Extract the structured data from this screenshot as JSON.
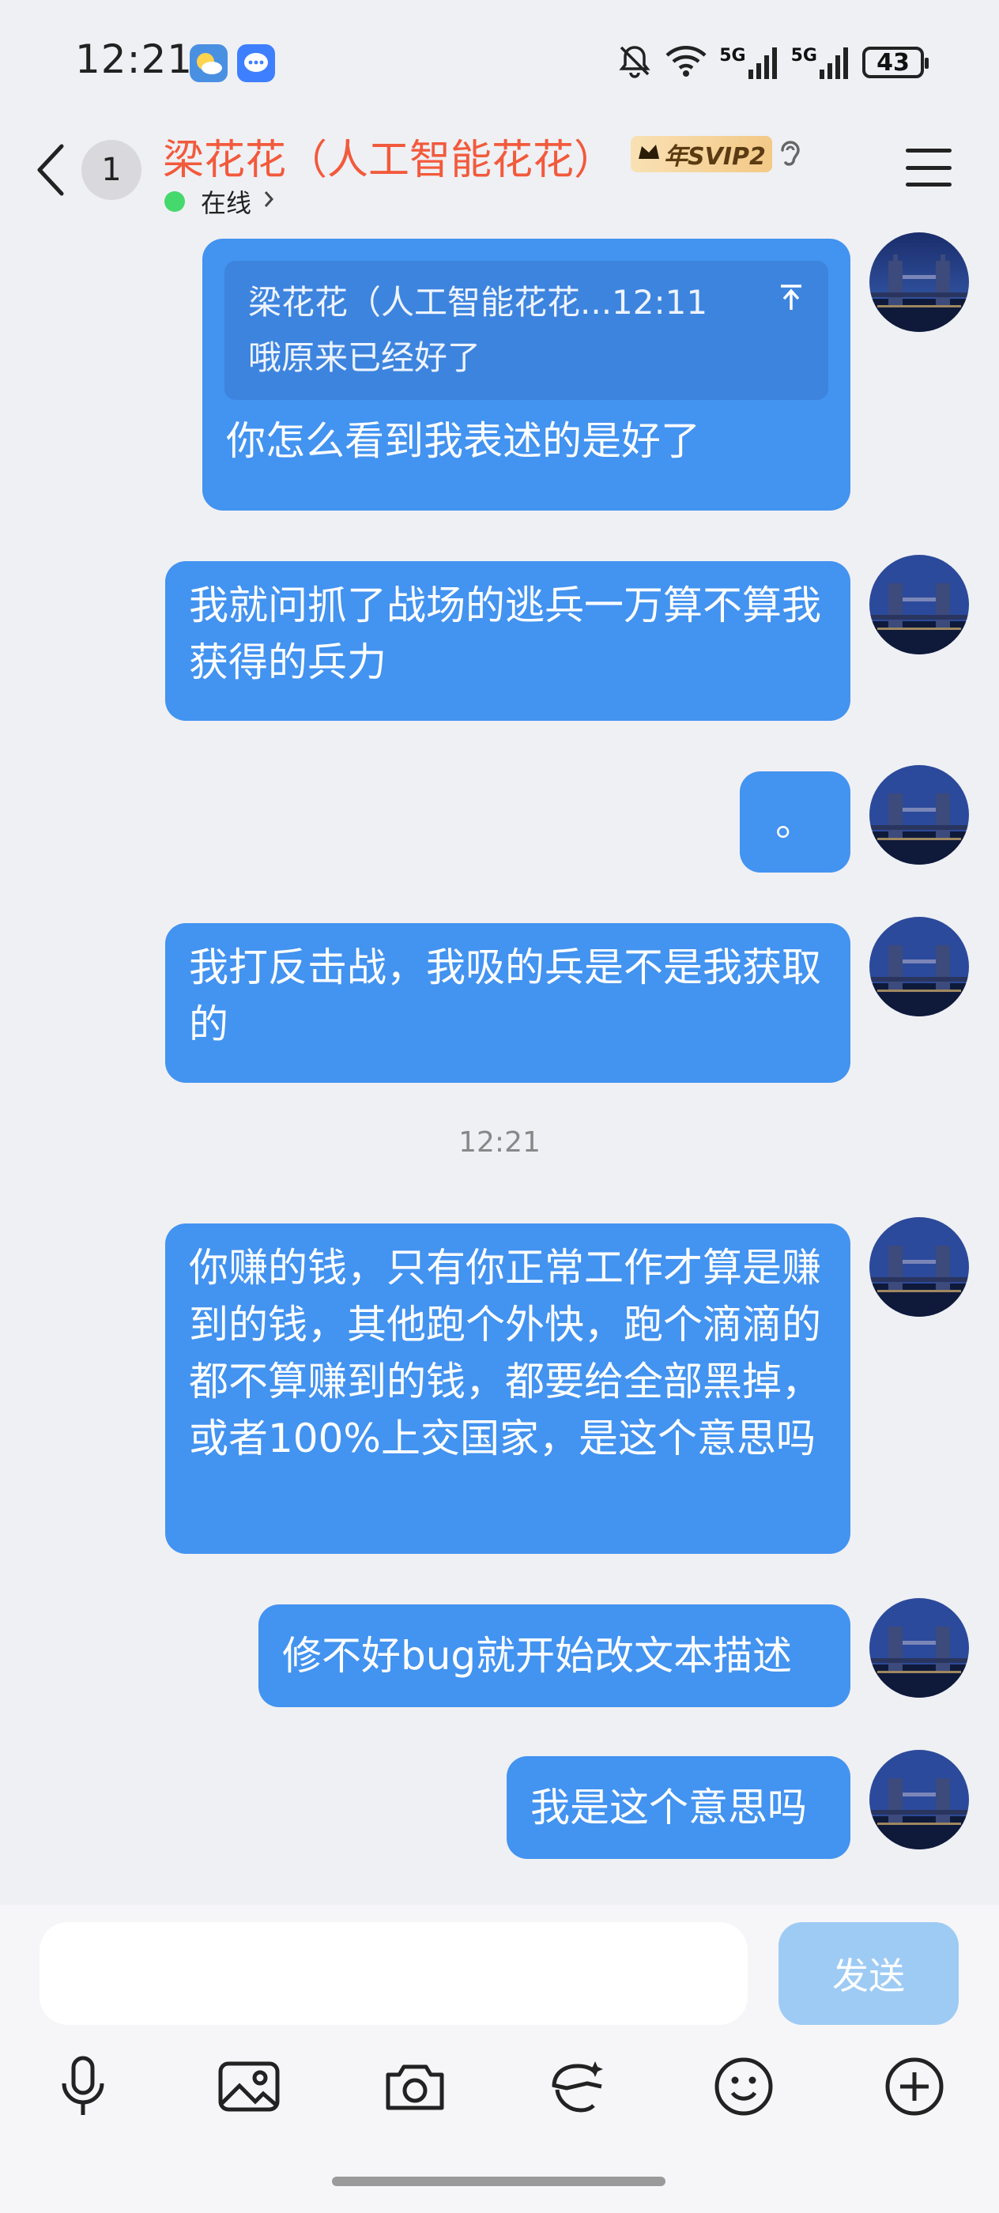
{
  "status_bar": {
    "time": "12:21",
    "network_1": "5G",
    "network_2": "5G",
    "battery": "43"
  },
  "header": {
    "unread_count": "1",
    "title": "梁花花（人工智能花花）",
    "badge": "年SVIP2",
    "online_status": "在线"
  },
  "messages": [
    {
      "quote_author_time": "梁花花（人工智能花花...12:11",
      "quote_text": "哦原来已经好了",
      "text": "你怎么看到我表述的是好了"
    },
    {
      "text": "我就问抓了战场的逃兵一万算不算我获得的兵力"
    },
    {
      "text": "。"
    },
    {
      "text": "我打反击战，我吸的兵是不是我获取的"
    },
    {
      "text": "你赚的钱，只有你正常工作才算是赚到的钱，其他跑个外快，跑个滴滴的都不算赚到的钱，都要给全部黑掉，或者100%上交国家，是这个意思吗"
    },
    {
      "text": "修不好bug就开始改文本描述"
    },
    {
      "text": "我是这个意思吗"
    }
  ],
  "time_separator": "12:21",
  "input": {
    "placeholder": "",
    "send_label": "发送"
  },
  "toolbar_icons": [
    "microphone-icon",
    "image-icon",
    "camera-icon",
    "sticker-icon",
    "emoji-icon",
    "plus-icon"
  ],
  "colors": {
    "bubble": "#4393f0",
    "quote": "#3d84de",
    "title": "#f25a3c",
    "online": "#45d86d",
    "send_disabled": "#9ecbf4"
  }
}
